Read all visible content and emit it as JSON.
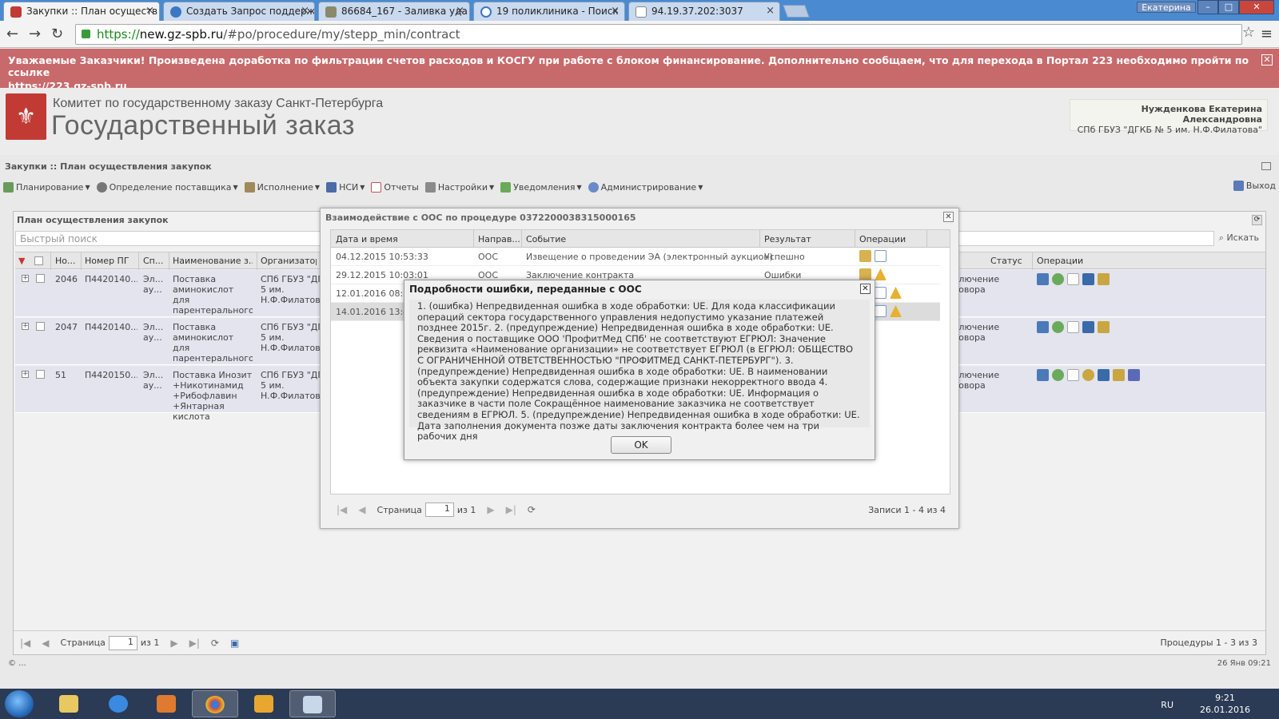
{
  "browser": {
    "tabs": [
      {
        "title": "Закупки :: План осуществ",
        "icon": "gz-spb-icon"
      },
      {
        "title": "Создать Запрос поддерж",
        "icon": "globe-icon"
      },
      {
        "title": "86684_167 - Заливка уда",
        "icon": "image-icon"
      },
      {
        "title": "19 поликлиника - Поиск",
        "icon": "google-icon"
      },
      {
        "title": "94.19.37.202:3037",
        "icon": "page-icon"
      }
    ],
    "user_chip": "Екатерина",
    "url_https": "https://",
    "url_host": "new.gz-spb.ru",
    "url_path": "/#po/procedure/my/stepp_min/contract"
  },
  "notice": {
    "text": "Уважаемые Заказчики! Произведена доработка по фильтрации счетов расходов и КОСГУ при работе с блоком финансирование. Дополнительно сообщаем, что для перехода в Портал 223 необходимо пройти по ссылке",
    "link": "https://223.gz-spb.ru",
    "color": "#c8696b"
  },
  "portal": {
    "org_line1": "Комитет по государственному заказу Санкт-Петербурга",
    "org_line2": "Государственный заказ",
    "user_name": "Нужденкова Екатерина Александровна",
    "user_org": "СПб ГБУЗ \"ДГКБ № 5 им. Н.Ф.Филатова\""
  },
  "app": {
    "title": "Закупки :: План осуществления закупок",
    "menu": [
      {
        "label": "Планирование",
        "icon": "planning-icon"
      },
      {
        "label": "Определение поставщика",
        "icon": "gear-icon"
      },
      {
        "label": "Исполнение",
        "icon": "execution-icon"
      },
      {
        "label": "НСИ",
        "icon": "book-icon"
      },
      {
        "label": "Отчеты",
        "icon": "report-icon"
      },
      {
        "label": "Настройки",
        "icon": "wrench-icon"
      },
      {
        "label": "Уведомления",
        "icon": "notification-icon"
      },
      {
        "label": "Администрирование",
        "icon": "user-icon"
      }
    ],
    "logout": "Выход"
  },
  "grid": {
    "title": "План осуществления закупок",
    "search_placeholder": "Быстрый поиск",
    "search_button": "Искать",
    "columns": [
      "Но...",
      "Номер ПГ",
      "Сп...",
      "Наименование з...",
      "Организатор",
      "Статус",
      "Операции"
    ],
    "rows": [
      {
        "num": "2046",
        "pg": "П4420140...",
        "method": "Эл... ау...",
        "name": "Поставка аминокислот для парентерального питания",
        "org": "СПб ГБУЗ \"ДГ 5 им. Н.Ф.Филатова",
        "status": "Заключение договора"
      },
      {
        "num": "2047",
        "pg": "П4420140...",
        "method": "Эл... ау...",
        "name": "Поставка аминокислот для парентерального питания",
        "org": "СПб ГБУЗ \"ДГ 5 им. Н.Ф.Филатова",
        "status": "Заключение договора"
      },
      {
        "num": "51",
        "pg": "П4420150...",
        "method": "Эл... ау...",
        "name": "Поставка Инозит +Никотинамид +Рибофлавин +Янтарная кислота",
        "org": "СПб ГБУЗ \"ДГ 5 им. Н.Ф.Филатова",
        "status": "Заключение договора"
      }
    ],
    "pager": {
      "page_label": "Страница",
      "page": "1",
      "of": "из 1",
      "info": "Процедуры 1 - 3 из 3"
    }
  },
  "interaction_dialog": {
    "title": "Взаимодействие с ООС по процедуре 0372200038315000165",
    "columns": [
      "Дата и время",
      "Направ...",
      "Событие",
      "Результат",
      "Операции"
    ],
    "rows": [
      {
        "date": "04.12.2015 10:53:33",
        "dir": "ООС",
        "event": "Извещение о проведении ЭА (электронный аукцион)",
        "result": "Успешно"
      },
      {
        "date": "29.12.2015 10:03:01",
        "dir": "ООС",
        "event": "Заключение контракта",
        "result": "Ошибки"
      },
      {
        "date": "12.01.2016 08:34",
        "dir": "",
        "event": "",
        "result": ""
      },
      {
        "date": "14.01.2016 13:41",
        "dir": "",
        "event": "",
        "result": ""
      }
    ],
    "pager": {
      "page_label": "Страница",
      "page": "1",
      "of": "из 1",
      "info": "Записи 1 - 4 из 4"
    }
  },
  "error_dialog": {
    "title": "Подробности ошибки, переданные с ООС",
    "message": "1. (ошибка) Непредвиденная ошибка в ходе обработки: UE. Для кода классификации операций сектора государственного управления недопустимо указание платежей позднее 2015г. 2. (предупреждение) Непредвиденная ошибка в ходе обработки: UE. Сведения о поставщике ООО 'ПрофитМед СПб' не соответствуют ЕГРЮЛ: Значение реквизита «Наименование организации» не соответствует ЕГРЮЛ (в ЕГРЮЛ: ОБЩЕСТВО С ОГРАНИЧЕННОЙ ОТВЕТСТВЕННОСТЬЮ \"ПРОФИТМЕД САНКТ-ПЕТЕРБУРГ\"). 3. (предупреждение) Непредвиденная ошибка в ходе обработки: UE. В наименовании объекта закупки содержатся слова, содержащие признаки некорректного ввода 4. (предупреждение) Непредвиденная ошибка в ходе обработки: UE. Информация о заказчике в части поле Сокращённое наименование заказчика не соответствует сведениям в ЕГРЮЛ. 5. (предупреждение) Непредвиденная ошибка в ходе обработки: UE. Дата заполнения документа позже даты заключения контракта более чем на три рабочих дня",
    "ok": "OK"
  },
  "footer": {
    "copyright": "© ...",
    "date": "26 Янв 09:21"
  },
  "taskbar": {
    "lang": "RU",
    "time": "9:21",
    "date": "26.01.2016"
  }
}
